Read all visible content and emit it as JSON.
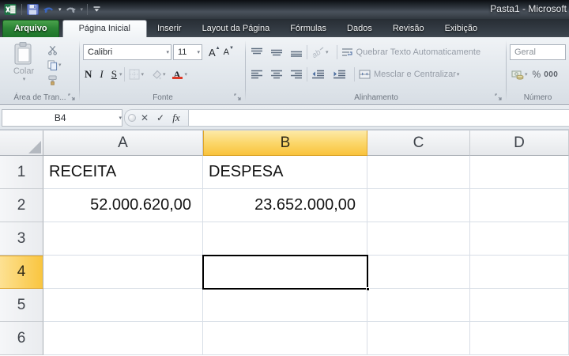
{
  "window": {
    "title": "Pasta1 - Microsoft"
  },
  "tabs": [
    {
      "label": "Arquivo",
      "type": "file",
      "active": false
    },
    {
      "label": "Página Inicial",
      "type": "normal",
      "active": true
    },
    {
      "label": "Inserir",
      "type": "normal",
      "active": false
    },
    {
      "label": "Layout da Página",
      "type": "normal",
      "active": false
    },
    {
      "label": "Fórmulas",
      "type": "normal",
      "active": false
    },
    {
      "label": "Dados",
      "type": "normal",
      "active": false
    },
    {
      "label": "Revisão",
      "type": "normal",
      "active": false
    },
    {
      "label": "Exibição",
      "type": "normal",
      "active": false
    }
  ],
  "ribbon": {
    "clipboard": {
      "paste_label": "Colar",
      "group_label": "Área de Tran...",
      "dropdown_glyph": "▾"
    },
    "font": {
      "font_name": "Calibri",
      "font_size": "11",
      "bold": "N",
      "italic": "I",
      "underline": "S",
      "grow_letter": "A",
      "shrink_letter": "A",
      "font_color_letter": "A",
      "group_label": "Fonte"
    },
    "alignment": {
      "wrap_text": "Quebrar Texto Automaticamente",
      "merge_center": "Mesclar e Centralizar",
      "group_label": "Alinhamento"
    },
    "number": {
      "format": "Geral",
      "percent": "%",
      "thousands": "000",
      "group_label": "Número"
    }
  },
  "formula_bar": {
    "name_box": "B4",
    "cancel_glyph": "✕",
    "enter_glyph": "✓",
    "fx_label": "fx",
    "formula": ""
  },
  "sheet": {
    "columns": [
      "A",
      "B",
      "C",
      "D"
    ],
    "rows": [
      "1",
      "2",
      "3",
      "4",
      "5",
      "6"
    ],
    "selected_column": "B",
    "selected_row": "4",
    "active_cell": "B4",
    "cells": [
      {
        "ref": "A1",
        "text": "RECEITA",
        "align": "left"
      },
      {
        "ref": "B1",
        "text": "DESPESA",
        "align": "left"
      },
      {
        "ref": "A2",
        "text": "52.000.620,00",
        "align": "right"
      },
      {
        "ref": "B2",
        "text": "23.652.000,00",
        "align": "right"
      }
    ]
  },
  "colors": {
    "selection_header": "#f9c33c",
    "file_tab_green": "#2c8536",
    "font_color_red": "#dd3a28",
    "title_bar_dark": "#31383f"
  }
}
